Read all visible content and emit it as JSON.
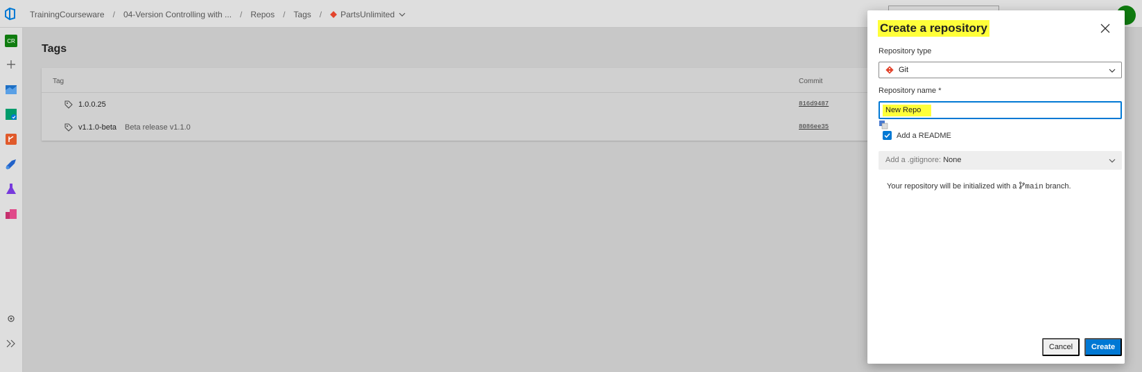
{
  "breadcrumb": {
    "items": [
      "TrainingCourseware",
      "04-Version Controlling with ...",
      "Repos",
      "Tags",
      "PartsUnlimited"
    ]
  },
  "leftnav": {
    "avatar_initials": "CR"
  },
  "page": {
    "title": "Tags"
  },
  "table": {
    "headers": {
      "tag": "Tag",
      "commit": "Commit"
    },
    "rows": [
      {
        "name": "1.0.0.25",
        "description": "",
        "commit": "816d9487"
      },
      {
        "name": "v1.1.0-beta",
        "description": "Beta release v1.1.0",
        "commit": "8086ee35"
      }
    ]
  },
  "dialog": {
    "title": "Create a repository",
    "repo_type_label": "Repository type",
    "repo_type_value": "Git",
    "repo_name_label": "Repository name *",
    "repo_name_value": "New Repo",
    "add_readme_label": "Add a README",
    "add_readme_checked": true,
    "gitignore_label": "Add a .gitignore:",
    "gitignore_value": "None",
    "info_prefix": "Your repository will be initialized with a",
    "info_branch": "main",
    "info_suffix": "branch.",
    "cancel_label": "Cancel",
    "create_label": "Create"
  },
  "colors": {
    "accent": "#0078d4",
    "highlight": "#ffff3a",
    "git_icon": "#e3442c",
    "avatar": "#107c10"
  }
}
